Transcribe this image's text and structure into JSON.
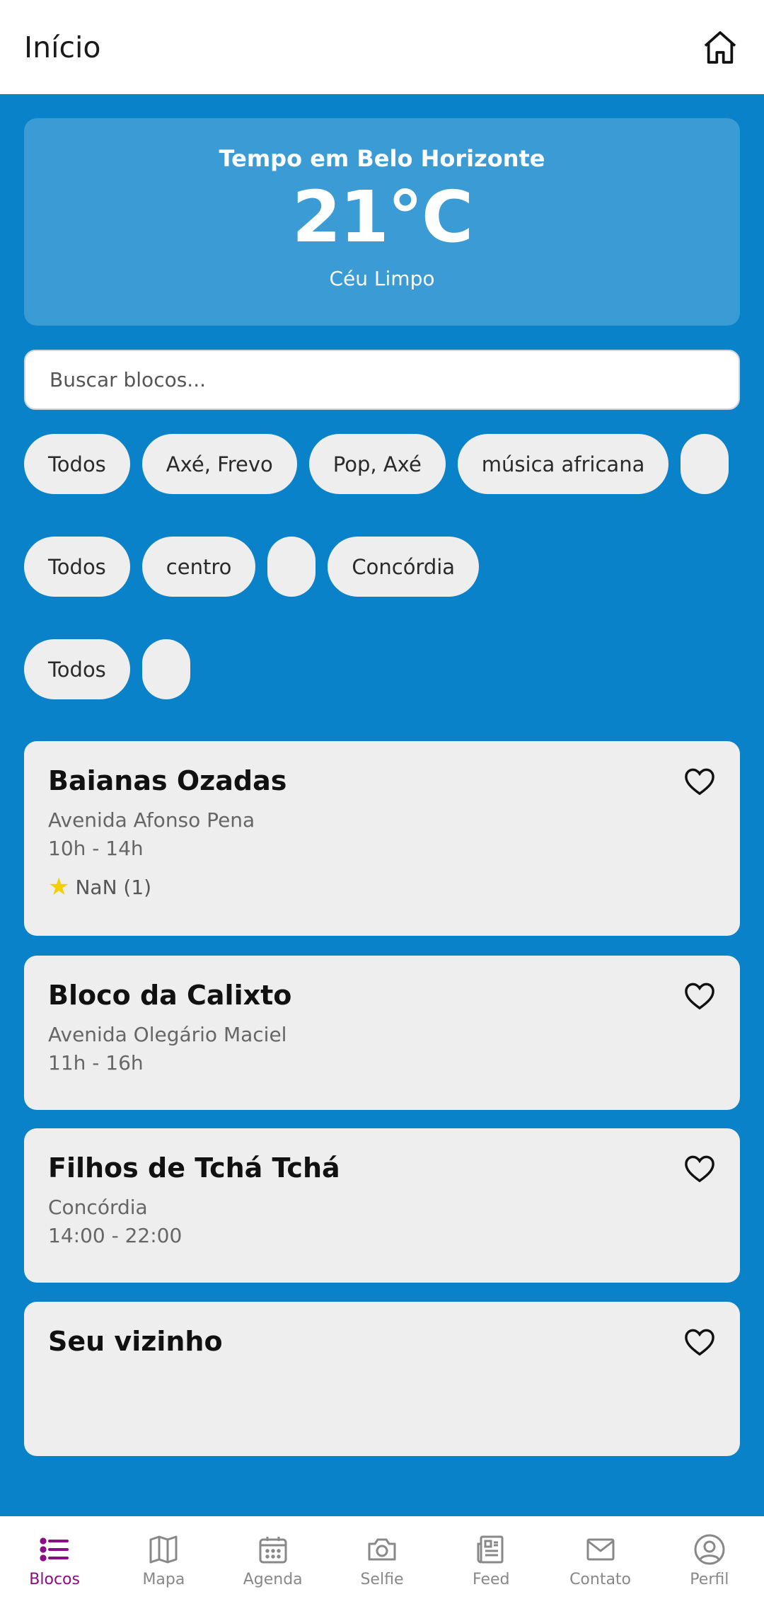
{
  "header": {
    "title": "Início"
  },
  "weather": {
    "title": "Tempo em Belo Horizonte",
    "temperature": "21°C",
    "condition": "Céu Limpo"
  },
  "search": {
    "placeholder": "Buscar blocos..."
  },
  "filters": {
    "row1": [
      "Todos",
      "Axé, Frevo",
      "Pop, Axé",
      "música africana",
      ""
    ],
    "row2": [
      "Todos",
      "centro",
      "",
      "Concórdia"
    ],
    "row3": [
      "Todos",
      ""
    ]
  },
  "blocos": [
    {
      "name": "Baianas Ozadas",
      "address": "Avenida Afonso Pena",
      "time": "10h - 14h",
      "rating": "NaN (1)"
    },
    {
      "name": "Bloco da Calixto",
      "address": "Avenida Olegário Maciel",
      "time": "11h - 16h"
    },
    {
      "name": "Filhos de Tchá Tchá",
      "address": "Concórdia",
      "time": "14:00 - 22:00"
    },
    {
      "name": "Seu vizinho"
    }
  ],
  "tabs": [
    {
      "label": "Blocos",
      "icon": "list-icon",
      "active": true
    },
    {
      "label": "Mapa",
      "icon": "map-icon"
    },
    {
      "label": "Agenda",
      "icon": "calendar-icon"
    },
    {
      "label": "Selfie",
      "icon": "camera-icon"
    },
    {
      "label": "Feed",
      "icon": "newspaper-icon"
    },
    {
      "label": "Contato",
      "icon": "mail-icon"
    },
    {
      "label": "Perfil",
      "icon": "user-icon"
    }
  ],
  "colors": {
    "background": "#0a82c9",
    "weather_card": "#3a9bd5",
    "active_tab": "#8b0d86",
    "star": "#f4d000"
  }
}
